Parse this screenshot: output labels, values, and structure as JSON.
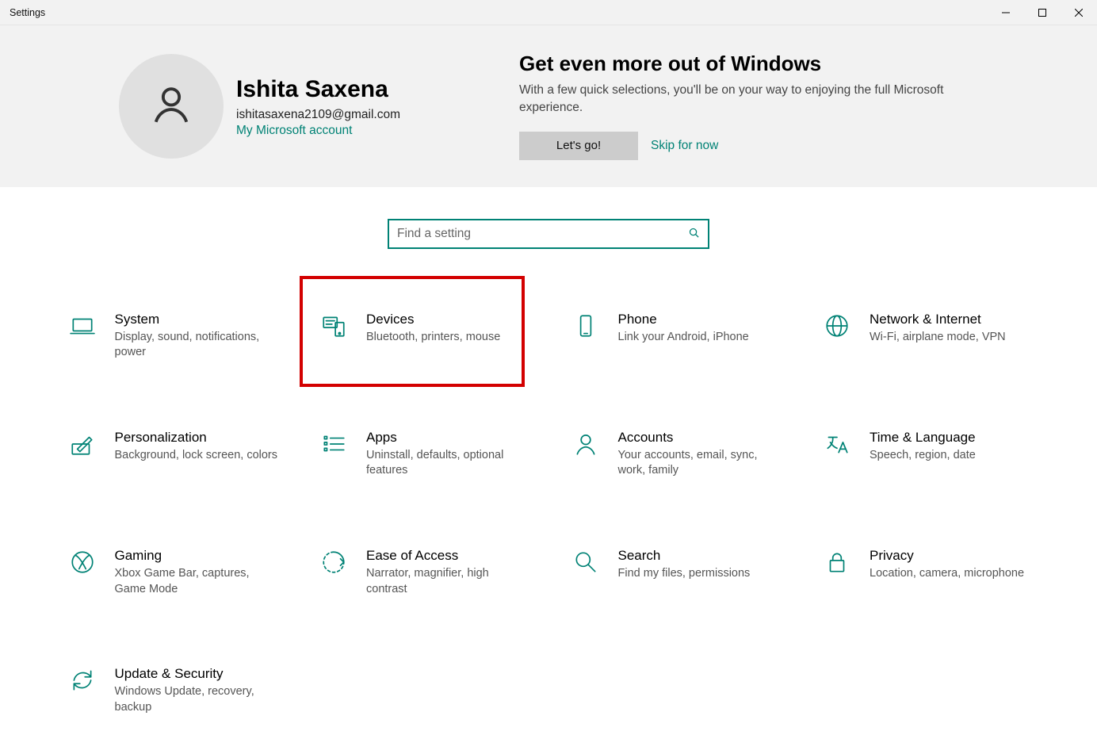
{
  "window": {
    "title": "Settings"
  },
  "account": {
    "name": "Ishita Saxena",
    "email": "ishitasaxena2109@gmail.com",
    "link_label": "My Microsoft account"
  },
  "promo": {
    "title": "Get even more out of Windows",
    "subtitle": "With a few quick selections, you'll be on your way to enjoying the full Microsoft experience.",
    "primary_button": "Let's go!",
    "skip_link": "Skip for now"
  },
  "search": {
    "placeholder": "Find a setting"
  },
  "categories": [
    {
      "key": "system",
      "label": "System",
      "desc": "Display, sound, notifications, power",
      "icon": "laptop"
    },
    {
      "key": "devices",
      "label": "Devices",
      "desc": "Bluetooth, printers, mouse",
      "icon": "devices",
      "highlighted": true
    },
    {
      "key": "phone",
      "label": "Phone",
      "desc": "Link your Android, iPhone",
      "icon": "phone"
    },
    {
      "key": "network",
      "label": "Network & Internet",
      "desc": "Wi-Fi, airplane mode, VPN",
      "icon": "globe"
    },
    {
      "key": "personalization",
      "label": "Personalization",
      "desc": "Background, lock screen, colors",
      "icon": "pen"
    },
    {
      "key": "apps",
      "label": "Apps",
      "desc": "Uninstall, defaults, optional features",
      "icon": "list"
    },
    {
      "key": "accounts",
      "label": "Accounts",
      "desc": "Your accounts, email, sync, work, family",
      "icon": "person"
    },
    {
      "key": "time",
      "label": "Time & Language",
      "desc": "Speech, region, date",
      "icon": "language"
    },
    {
      "key": "gaming",
      "label": "Gaming",
      "desc": "Xbox Game Bar, captures, Game Mode",
      "icon": "xbox"
    },
    {
      "key": "ease",
      "label": "Ease of Access",
      "desc": "Narrator, magnifier, high contrast",
      "icon": "ease"
    },
    {
      "key": "search-cat",
      "label": "Search",
      "desc": "Find my files, permissions",
      "icon": "search"
    },
    {
      "key": "privacy",
      "label": "Privacy",
      "desc": "Location, camera, microphone",
      "icon": "lock"
    },
    {
      "key": "update",
      "label": "Update & Security",
      "desc": "Windows Update, recovery, backup",
      "icon": "update"
    }
  ],
  "colors": {
    "accent": "#008275",
    "highlight": "#d30000"
  }
}
